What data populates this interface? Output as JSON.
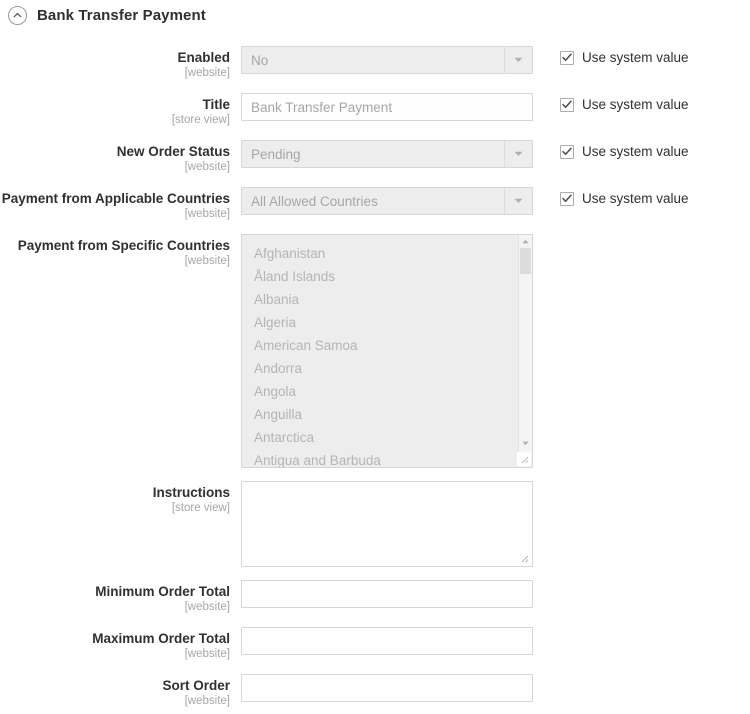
{
  "section": {
    "title": "Bank Transfer Payment",
    "collapse_icon": "chevron-up-circle-icon",
    "expanded": true
  },
  "use_system_value_label": "Use system value",
  "icons": {
    "dropdown": "caret-down-icon",
    "scroll_up": "caret-up-icon",
    "scroll_down": "caret-down-icon",
    "resize": "resize-grip-icon",
    "check": "check-icon"
  },
  "colors": {
    "page_background": "#ffffff",
    "label_text": "#303030",
    "scope_text": "#a6a6a6",
    "disabled_field_background": "#ededed",
    "field_border": "#d6d6d6",
    "disabled_text": "#a6a6a6",
    "option_text": "#b5b5b5"
  },
  "fields": [
    {
      "label": "Enabled",
      "scope": "[website]",
      "type": "select",
      "value": "No",
      "disabled": true,
      "use_system_value": true,
      "checked": true
    },
    {
      "label": "Title",
      "scope": "[store view]",
      "type": "text",
      "value": "Bank Transfer Payment",
      "disabled": true,
      "use_system_value": true,
      "checked": true
    },
    {
      "label": "New Order Status",
      "scope": "[website]",
      "type": "select",
      "value": "Pending",
      "disabled": true,
      "use_system_value": true,
      "checked": true
    },
    {
      "label": "Payment from Applicable Countries",
      "scope": "[website]",
      "type": "select",
      "value": "All Allowed Countries",
      "disabled": true,
      "use_system_value": true,
      "checked": true
    },
    {
      "label": "Payment from Specific Countries",
      "scope": "[website]",
      "type": "multiselect",
      "disabled": true,
      "use_system_value": false,
      "options": [
        "Afghanistan",
        "Åland Islands",
        "Albania",
        "Algeria",
        "American Samoa",
        "Andorra",
        "Angola",
        "Anguilla",
        "Antarctica",
        "Antigua and Barbuda"
      ]
    },
    {
      "label": "Instructions",
      "scope": "[store view]",
      "type": "textarea",
      "value": "",
      "disabled": false,
      "use_system_value": false
    },
    {
      "label": "Minimum Order Total",
      "scope": "[website]",
      "type": "text",
      "value": "",
      "disabled": false,
      "use_system_value": false
    },
    {
      "label": "Maximum Order Total",
      "scope": "[website]",
      "type": "text",
      "value": "",
      "disabled": false,
      "use_system_value": false
    },
    {
      "label": "Sort Order",
      "scope": "[website]",
      "type": "text",
      "value": "",
      "disabled": false,
      "use_system_value": false
    }
  ]
}
